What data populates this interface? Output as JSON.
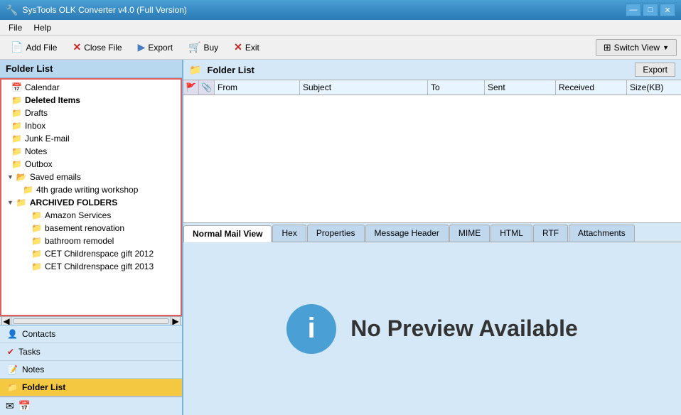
{
  "app": {
    "title": "SysTools OLK Converter v4.0 (Full Version)"
  },
  "menu": {
    "file": "File",
    "help": "Help"
  },
  "toolbar": {
    "add_file": "Add File",
    "close_file": "Close File",
    "export": "Export",
    "buy": "Buy",
    "exit": "Exit",
    "switch_view": "Switch View"
  },
  "left_panel": {
    "title": "Folder List"
  },
  "folder_tree": [
    {
      "id": "calendar",
      "label": "Calendar",
      "indent": 1,
      "icon": "calendar",
      "expand": false
    },
    {
      "id": "deleted",
      "label": "Deleted Items",
      "indent": 1,
      "icon": "deleted",
      "expand": false
    },
    {
      "id": "drafts",
      "label": "Drafts",
      "indent": 1,
      "icon": "drafts",
      "expand": false
    },
    {
      "id": "inbox",
      "label": "Inbox",
      "indent": 1,
      "icon": "inbox",
      "expand": false
    },
    {
      "id": "junk",
      "label": "Junk E-mail",
      "indent": 1,
      "icon": "junk",
      "expand": false
    },
    {
      "id": "notes",
      "label": "Notes",
      "indent": 1,
      "icon": "notes",
      "expand": false
    },
    {
      "id": "outbox",
      "label": "Outbox",
      "indent": 1,
      "icon": "outbox",
      "expand": false
    },
    {
      "id": "saved",
      "label": "Saved emails",
      "indent": 1,
      "icon": "saved",
      "expand": true
    },
    {
      "id": "4thgrade",
      "label": "4th grade writing workshop",
      "indent": 2,
      "icon": "subfolder",
      "expand": false
    },
    {
      "id": "archived",
      "label": "ARCHIVED FOLDERS",
      "indent": 1,
      "icon": "archived",
      "expand": true
    },
    {
      "id": "amazon",
      "label": "Amazon Services",
      "indent": 3,
      "icon": "subfolder",
      "expand": false
    },
    {
      "id": "basement",
      "label": "basement renovation",
      "indent": 3,
      "icon": "subfolder",
      "expand": false
    },
    {
      "id": "bathroom",
      "label": "bathroom remodel",
      "indent": 3,
      "icon": "subfolder",
      "expand": false
    },
    {
      "id": "cet2012",
      "label": "CET Childrenspace gift 2012",
      "indent": 3,
      "icon": "subfolder",
      "expand": false
    },
    {
      "id": "cet2013",
      "label": "CET Childrenspace gift 2013",
      "indent": 3,
      "icon": "subfolder",
      "expand": false
    }
  ],
  "email_columns": {
    "flag": "",
    "clip": "",
    "from": "From",
    "subject": "Subject",
    "to": "To",
    "sent": "Sent",
    "received": "Received",
    "size": "Size(KB)"
  },
  "tabs": [
    {
      "id": "normal",
      "label": "Normal Mail View",
      "active": true
    },
    {
      "id": "hex",
      "label": "Hex",
      "active": false
    },
    {
      "id": "properties",
      "label": "Properties",
      "active": false
    },
    {
      "id": "message_header",
      "label": "Message Header",
      "active": false
    },
    {
      "id": "mime",
      "label": "MIME",
      "active": false
    },
    {
      "id": "html",
      "label": "HTML",
      "active": false
    },
    {
      "id": "rtf",
      "label": "RTF",
      "active": false
    },
    {
      "id": "attachments",
      "label": "Attachments",
      "active": false
    }
  ],
  "preview": {
    "icon": "i",
    "text": "No Preview Available"
  },
  "right_panel": {
    "title": "Folder List",
    "export": "Export"
  },
  "bottom_nav": [
    {
      "id": "contacts",
      "label": "Contacts",
      "icon": "contacts"
    },
    {
      "id": "tasks",
      "label": "Tasks",
      "icon": "tasks"
    },
    {
      "id": "notes",
      "label": "Notes",
      "icon": "notes-nav"
    },
    {
      "id": "folderlist",
      "label": "Folder List",
      "icon": "folderlist",
      "active": true
    }
  ],
  "title_controls": {
    "minimize": "—",
    "maximize": "□",
    "close": "✕"
  }
}
